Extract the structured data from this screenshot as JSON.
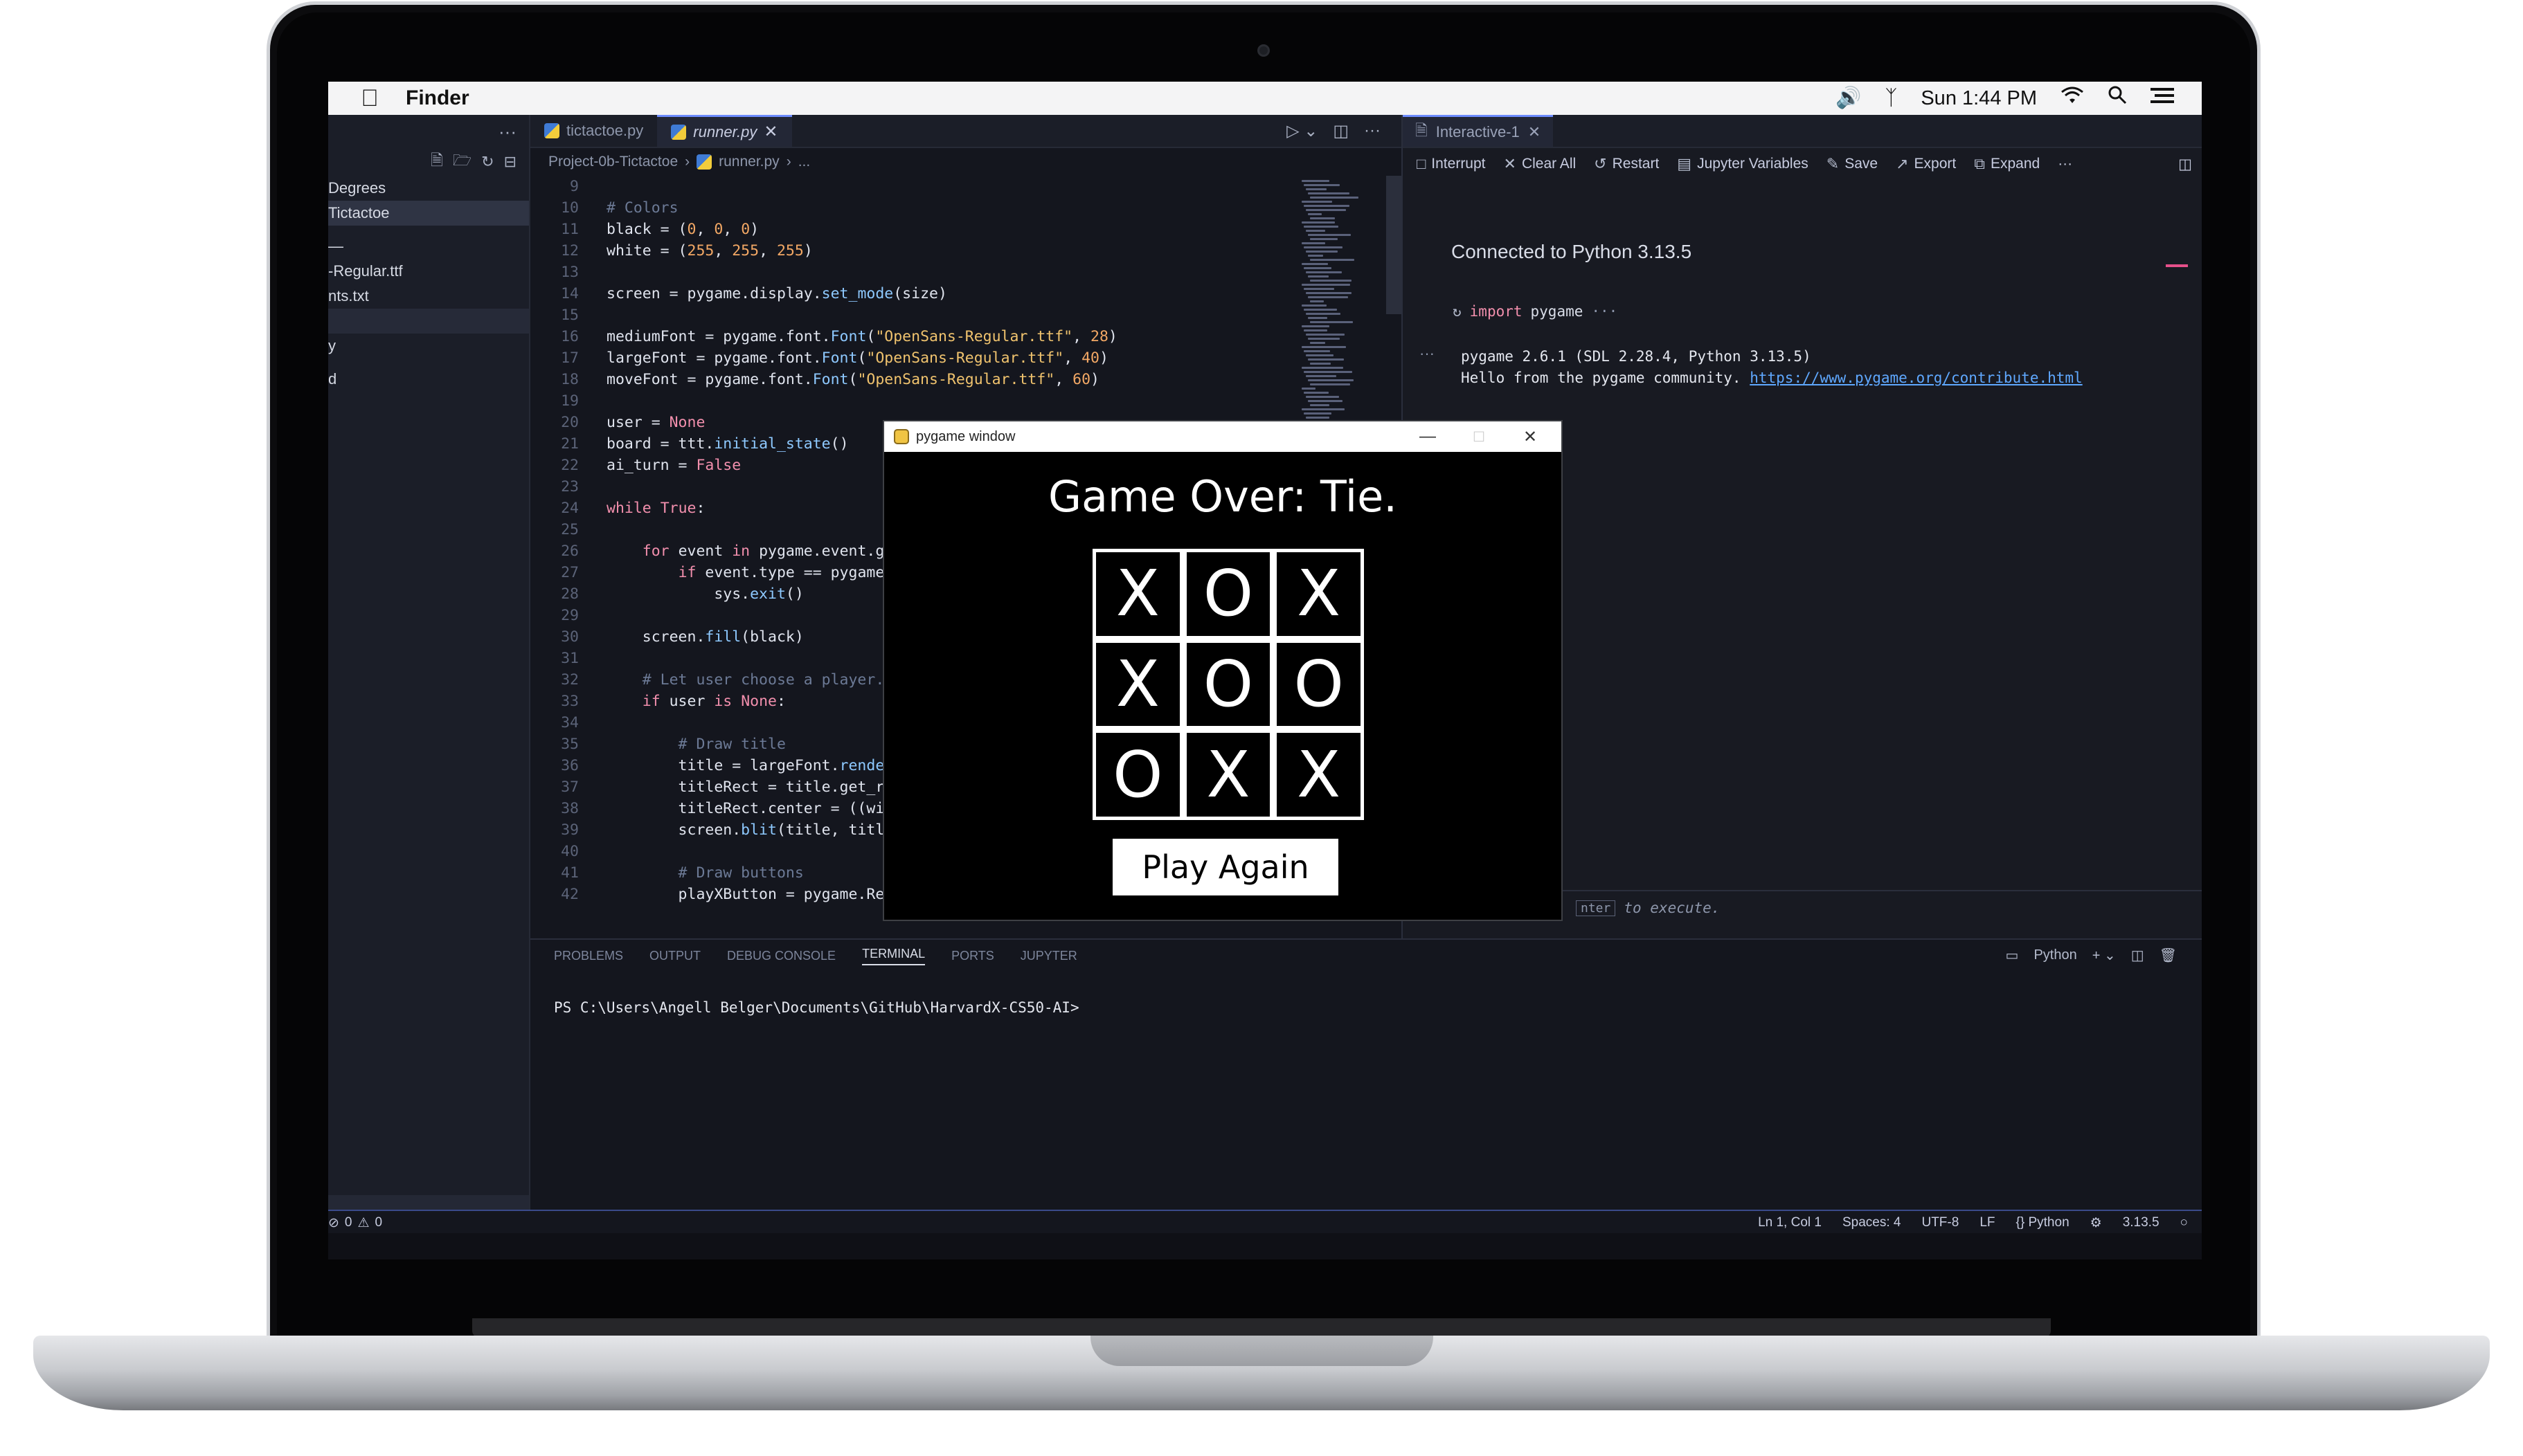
{
  "menubar": {
    "app_name": "Finder",
    "clock": "Sun 1:44 PM"
  },
  "sidebar": {
    "more": "···",
    "items": [
      "Degrees",
      "Tictactoe",
      "—",
      "-Regular.ttf",
      "nts.txt",
      "",
      "y",
      "d"
    ]
  },
  "editor": {
    "tabs": [
      {
        "label": "tictactoe.py"
      },
      {
        "label": "runner.py"
      }
    ],
    "breadcrumb": [
      "Project-0b-Tictactoe",
      "runner.py",
      "..."
    ],
    "lines": [
      {
        "n": "9",
        "t": ""
      },
      {
        "n": "10",
        "t": "# Colors"
      },
      {
        "n": "11",
        "t": "black = (0, 0, 0)"
      },
      {
        "n": "12",
        "t": "white = (255, 255, 255)"
      },
      {
        "n": "13",
        "t": ""
      },
      {
        "n": "14",
        "t": "screen = pygame.display.set_mode(size)"
      },
      {
        "n": "15",
        "t": ""
      },
      {
        "n": "16",
        "t": "mediumFont = pygame.font.Font(\"OpenSans-Regular.ttf\", 28)"
      },
      {
        "n": "17",
        "t": "largeFont = pygame.font.Font(\"OpenSans-Regular.ttf\", 40)"
      },
      {
        "n": "18",
        "t": "moveFont = pygame.font.Font(\"OpenSans-Regular.ttf\", 60)"
      },
      {
        "n": "19",
        "t": ""
      },
      {
        "n": "20",
        "t": "user = None"
      },
      {
        "n": "21",
        "t": "board = ttt.initial_state()"
      },
      {
        "n": "22",
        "t": "ai_turn = False"
      },
      {
        "n": "23",
        "t": ""
      },
      {
        "n": "24",
        "t": "while True:"
      },
      {
        "n": "25",
        "t": ""
      },
      {
        "n": "26",
        "t": "    for event in pygame.event.ge"
      },
      {
        "n": "27",
        "t": "        if event.type == pygame."
      },
      {
        "n": "28",
        "t": "            sys.exit()"
      },
      {
        "n": "29",
        "t": ""
      },
      {
        "n": "30",
        "t": "    screen.fill(black)"
      },
      {
        "n": "31",
        "t": ""
      },
      {
        "n": "32",
        "t": "    # Let user choose a player."
      },
      {
        "n": "33",
        "t": "    if user is None:"
      },
      {
        "n": "34",
        "t": ""
      },
      {
        "n": "35",
        "t": "        # Draw title"
      },
      {
        "n": "36",
        "t": "        title = largeFont.render"
      },
      {
        "n": "37",
        "t": "        titleRect = title.get_re"
      },
      {
        "n": "38",
        "t": "        titleRect.center = ((wic"
      },
      {
        "n": "39",
        "t": "        screen.blit(title, title"
      },
      {
        "n": "40",
        "t": ""
      },
      {
        "n": "41",
        "t": "        # Draw buttons"
      },
      {
        "n": "42",
        "t": "        playXButton = pygame.Rec"
      }
    ]
  },
  "interactive": {
    "tab_label": "Interactive-1",
    "toolbar": {
      "interrupt": "Interrupt",
      "clear_all": "Clear All",
      "restart": "Restart",
      "variables": "Jupyter Variables",
      "save": "Save",
      "export": "Export",
      "expand": "Expand",
      "more": "···"
    },
    "status": "Connected to Python 3.13.5",
    "cell_code": "import pygame",
    "cell_more": "···",
    "output_line1": "pygame 2.6.1 (SDL 2.28.4, Python 3.13.5)",
    "output_line2": "Hello from the pygame community. ",
    "output_link": "https://www.pygame.org/contribute.html",
    "input_key": "nter",
    "input_hint": "to execute."
  },
  "panel": {
    "tabs": [
      "PROBLEMS",
      "OUTPUT",
      "DEBUG CONSOLE",
      "TERMINAL",
      "PORTS",
      "JUPYTER"
    ],
    "active_tab": "TERMINAL",
    "shell_label": "Python",
    "prompt": "PS C:\\Users\\Angell Belger\\Documents\\GitHub\\HarvardX-CS50-AI>"
  },
  "statusbar": {
    "problems": "0",
    "warnings": "0",
    "position": "Ln 1, Col 1",
    "spaces": "Spaces: 4",
    "encoding": "UTF-8",
    "eol": "LF",
    "language": "Python",
    "version": "3.13.5"
  },
  "pygame": {
    "window_title": "pygame window",
    "heading": "Game Over: Tie.",
    "board": [
      "X",
      "O",
      "X",
      "X",
      "O",
      "O",
      "O",
      "X",
      "X"
    ],
    "button": "Play Again"
  },
  "icons": {
    "apple": "apple-icon",
    "volume": "volume-icon",
    "bluetooth": "bluetooth-icon",
    "wifi": "wifi-icon",
    "search": "search-icon",
    "control_center": "list-icon"
  }
}
